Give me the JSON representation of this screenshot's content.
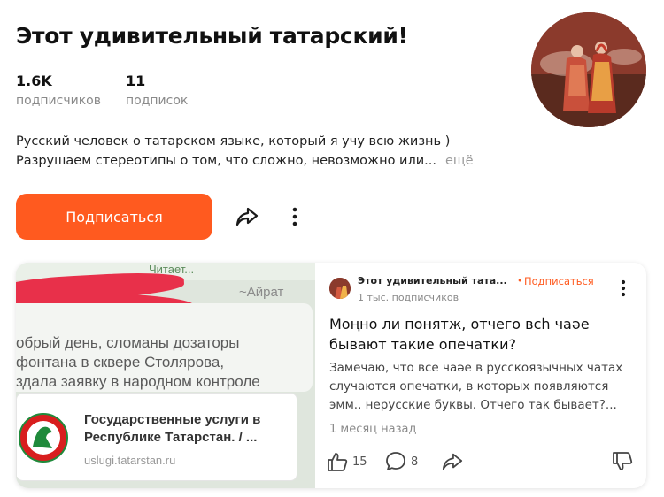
{
  "channel": {
    "title": "Этот удивительный татарский!",
    "stats": [
      {
        "value": "1.6K",
        "label": "подписчиков"
      },
      {
        "value": "11",
        "label": "подписок"
      }
    ],
    "description_line1": "Русский человек о татарском языке, который я учу всю жизнь )",
    "description_line2": "Разрушаем стереотипы о том, что сложно, невозможно или...",
    "more_label": "ещё",
    "subscribe_label": "Подписаться"
  },
  "post": {
    "image": {
      "bubble_text": [
        "обрый день, сломаны дозаторы",
        "фонтана в сквере Столярова,",
        "здала заявку в народном контроле"
      ],
      "signature": "~Айрат",
      "topbar": "Читает...",
      "link_title": "Государственные услуги в Республике Татарстан.  / ...",
      "link_url": "uslugi.tatarstan.ru"
    },
    "author": "Этот удивительный тата...",
    "author_subs": "1 тыс. подписчиков",
    "dot": "•",
    "subscribe_label": "Подписаться",
    "title": "Моңно ли понятж, отчего всһ чаәе бывают такие опечатки?",
    "text": "Замечаю, что все чаәе в русскоязычных чатах случаются опечатки, в которых появляются эмм.. нерусские буквы. Отчего так бывает?...",
    "time": "1 месяц назад",
    "likes": "15",
    "comments": "8"
  },
  "colors": {
    "accent": "#ff5a1f",
    "text": "#111111",
    "muted": "#8a8a8a"
  },
  "icons": [
    "share-icon",
    "more-vertical-icon",
    "thumbs-up-icon",
    "comment-icon",
    "thumbs-down-icon"
  ]
}
